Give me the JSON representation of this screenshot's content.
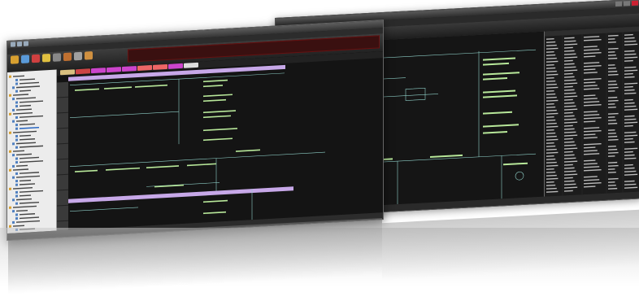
{
  "colors": {
    "ladder_bg": "#141414",
    "rung_line": "#8fd0c8",
    "contact_text": "#b8e89a",
    "highlight_tab": "#c7a8e8",
    "ribbon_strip": "#3a1010",
    "tree_bg": "#ececec"
  },
  "icons": [
    "minimize-icon",
    "maximize-icon",
    "close-icon",
    "save-icon",
    "undo-icon",
    "redo-icon"
  ]
}
